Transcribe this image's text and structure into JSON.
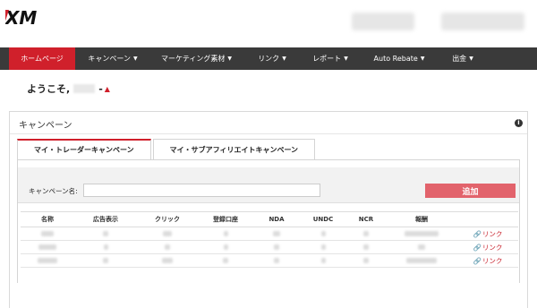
{
  "header": {
    "logo_text": "XM"
  },
  "nav": {
    "items": [
      {
        "label": "ホームページ",
        "active": true,
        "dropdown": false
      },
      {
        "label": "キャンペーン",
        "active": false,
        "dropdown": true
      },
      {
        "label": "マーケティング素材",
        "active": false,
        "dropdown": true
      },
      {
        "label": "リンク",
        "active": false,
        "dropdown": true
      },
      {
        "label": "レポート",
        "active": false,
        "dropdown": true
      },
      {
        "label": "Auto Rebate",
        "active": false,
        "dropdown": true
      },
      {
        "label": "出金",
        "active": false,
        "dropdown": true
      }
    ]
  },
  "welcome": {
    "text": "ようこそ,",
    "dash": "-"
  },
  "panel": {
    "title": "キャンペーン",
    "info_icon": "i",
    "tabs": [
      {
        "label": "マイ・トレーダーキャンペーン",
        "active": true
      },
      {
        "label": "マイ・サブアフィリエイトキャンペーン",
        "active": false
      }
    ],
    "search": {
      "label": "キャンペーン名:",
      "value": "",
      "button_label": "追加"
    },
    "table": {
      "headers": [
        "名称",
        "広告表示",
        "クリック",
        "登録口座",
        "NDA",
        "UNDC",
        "NCR",
        "報酬",
        ""
      ],
      "rows": [
        {
          "link_label": "リンク"
        },
        {
          "link_label": "リンク"
        },
        {
          "link_label": "リンク"
        }
      ]
    }
  },
  "colors": {
    "brand_red": "#d0202b",
    "nav_bg": "#3a3a3a",
    "add_button": "#e2636c"
  },
  "icons": [
    "info-icon",
    "bell-icon",
    "chevron-down-icon",
    "link-icon"
  ]
}
